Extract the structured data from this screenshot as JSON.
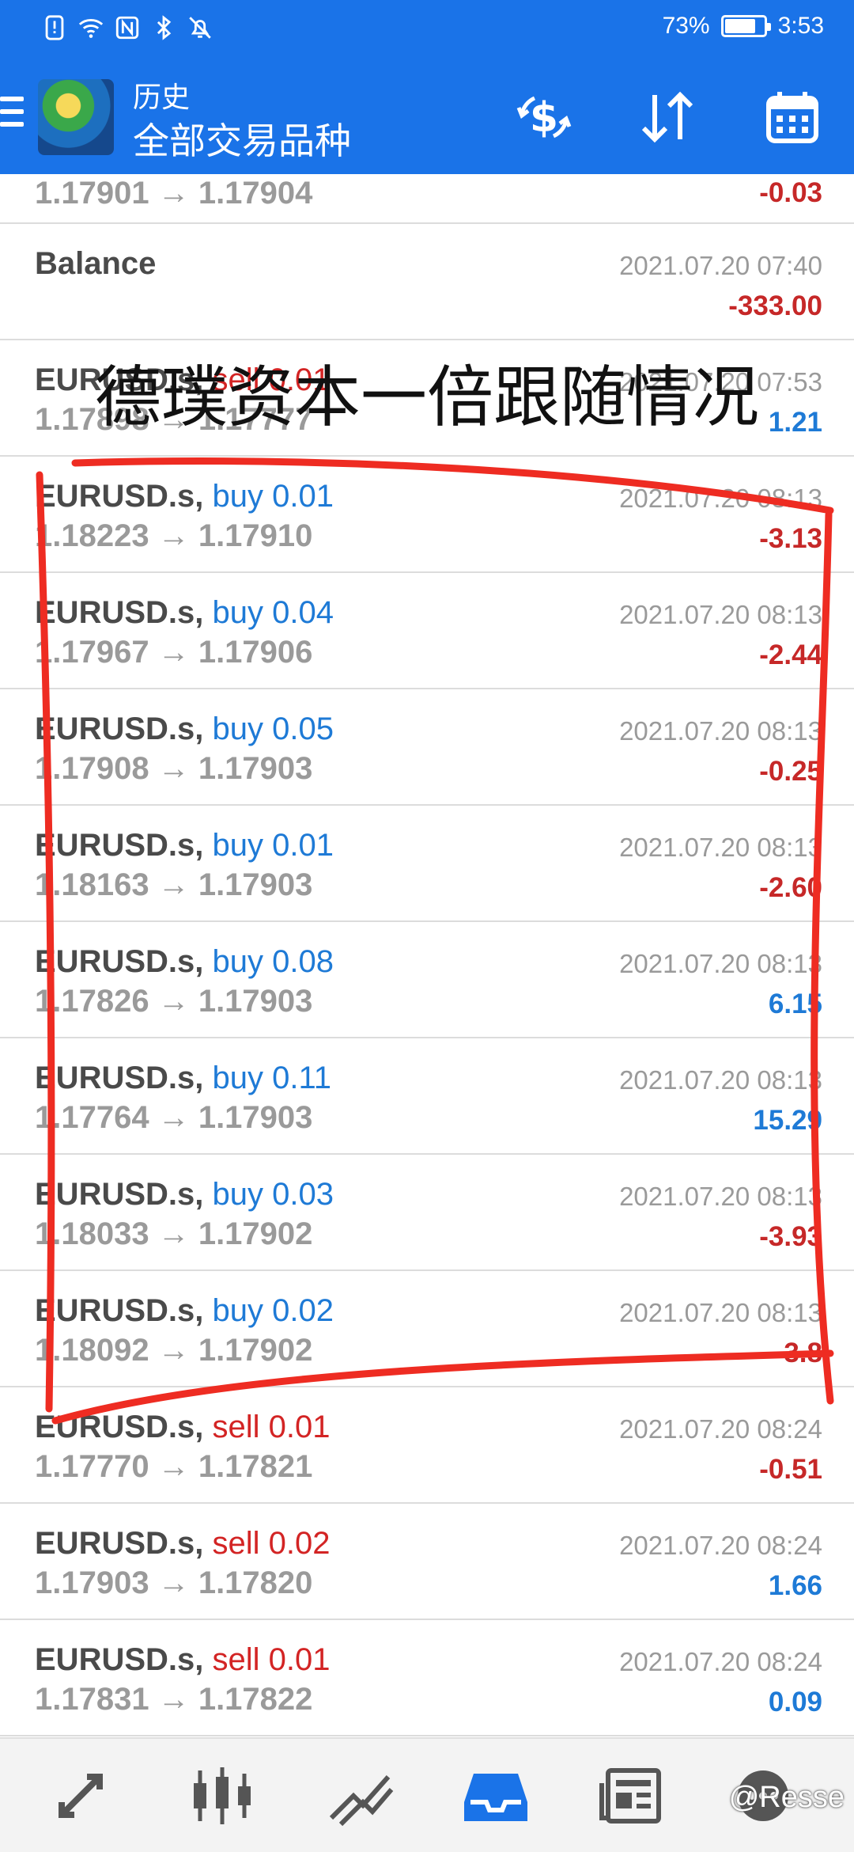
{
  "status_bar": {
    "battery_text": "73%",
    "battery_level": 0.73,
    "time": "3:53",
    "icons": [
      "alert-icon",
      "wifi-icon",
      "nfc-icon",
      "bluetooth-icon",
      "mute-bell-icon"
    ]
  },
  "header": {
    "title": "历史",
    "subtitle": "全部交易品种",
    "actions": [
      "currency-exchange-icon",
      "sort-icon",
      "calendar-icon"
    ]
  },
  "rows": [
    {
      "line2": "1.17901 → 1.17904",
      "profit": "-0.03",
      "sign": "neg"
    },
    {
      "line1": "Balance",
      "time": "2021.07.20 07:40",
      "profit": "-333.00",
      "sign": "neg"
    },
    {
      "symbol": "EURUSD.s,",
      "side": "sell",
      "lots": "sell 0.01",
      "line2": "1.17898 → 1.17777",
      "time": "2021.07.20 07:53",
      "profit": "1.21",
      "sign": "pos"
    },
    {
      "symbol": "EURUSD.s,",
      "side": "buy",
      "lots": "buy 0.01",
      "line2": "1.18223 → 1.17910",
      "time": "2021.07.20 08:13",
      "profit": "-3.13",
      "sign": "neg"
    },
    {
      "symbol": "EURUSD.s,",
      "side": "buy",
      "lots": "buy 0.04",
      "line2": "1.17967 → 1.17906",
      "time": "2021.07.20 08:13",
      "profit": "-2.44",
      "sign": "neg"
    },
    {
      "symbol": "EURUSD.s,",
      "side": "buy",
      "lots": "buy 0.05",
      "line2": "1.17908 → 1.17903",
      "time": "2021.07.20 08:13",
      "profit": "-0.25",
      "sign": "neg"
    },
    {
      "symbol": "EURUSD.s,",
      "side": "buy",
      "lots": "buy 0.01",
      "line2": "1.18163 → 1.17903",
      "time": "2021.07.20 08:13",
      "profit": "-2.60",
      "sign": "neg"
    },
    {
      "symbol": "EURUSD.s,",
      "side": "buy",
      "lots": "buy 0.08",
      "line2": "1.17826 → 1.17903",
      "time": "2021.07.20 08:13",
      "profit": "6.15",
      "sign": "pos"
    },
    {
      "symbol": "EURUSD.s,",
      "side": "buy",
      "lots": "buy 0.11",
      "line2": "1.17764 → 1.17903",
      "time": "2021.07.20 08:13",
      "profit": "15.29",
      "sign": "pos"
    },
    {
      "symbol": "EURUSD.s,",
      "side": "buy",
      "lots": "buy 0.03",
      "line2": "1.18033 → 1.17902",
      "time": "2021.07.20 08:13",
      "profit": "-3.93",
      "sign": "neg"
    },
    {
      "symbol": "EURUSD.s,",
      "side": "buy",
      "lots": "buy 0.02",
      "line2": "1.18092 → 1.17902",
      "time": "2021.07.20 08:13",
      "profit": "-3.8",
      "sign": "neg"
    },
    {
      "symbol": "EURUSD.s,",
      "side": "sell",
      "lots": "sell 0.01",
      "line2": "1.17770 → 1.17821",
      "time": "2021.07.20 08:24",
      "profit": "-0.51",
      "sign": "neg"
    },
    {
      "symbol": "EURUSD.s,",
      "side": "sell",
      "lots": "sell 0.02",
      "line2": "1.17903 → 1.17820",
      "time": "2021.07.20 08:24",
      "profit": "1.66",
      "sign": "pos"
    },
    {
      "symbol": "EURUSD.s,",
      "side": "sell",
      "lots": "sell 0.01",
      "line2": "1.17831 → 1.17822",
      "time": "2021.07.20 08:24",
      "profit": "0.09",
      "sign": "pos"
    }
  ],
  "overlay": {
    "caption": "德璞资本一倍跟随情况"
  },
  "bottom_nav": {
    "items": [
      "trade-icon",
      "chart-icon",
      "line-chart-icon",
      "history-inbox-icon",
      "news-icon",
      "chat-icon"
    ],
    "active": "history-inbox-icon"
  },
  "watermark": "@Resse",
  "colors": {
    "primary": "#1a73e8",
    "buy": "#1e7ad6",
    "sell": "#d32424",
    "annotation": "#ee2c22"
  }
}
